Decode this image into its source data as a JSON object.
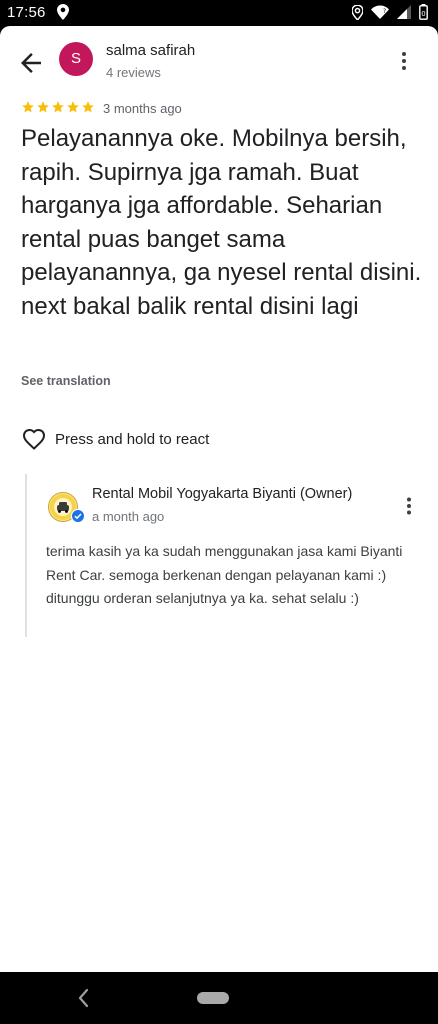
{
  "status_bar": {
    "time": "17:56"
  },
  "review": {
    "avatar_letter": "S",
    "avatar_color": "#c2185b",
    "reviewer_name": "salma safirah",
    "reviewer_reviews": "4 reviews",
    "rating": 5,
    "max_rating": 5,
    "time": "3 months ago",
    "text": "Pelayanannya oke. Mobilnya bersih, rapih. Supirnya jga ramah. Buat harganya jga affordable. Seharian rental puas banget sama pelayanannya, ga nyesel rental disini. next bakal balik rental disini lagi",
    "see_translation": "See translation",
    "react_label": "Press and hold to react"
  },
  "owner_reply": {
    "name": "Rental Mobil Yogyakarta Biyanti (Owner)",
    "time": "a month ago",
    "text": "terima kasih ya ka sudah menggunakan jasa kami Biyanti Rent Car. semoga berkenan dengan pelayanan kami :) ditunggu orderan selanjutnya ya ka. sehat selalu :)"
  },
  "colors": {
    "star": "#fbbc04",
    "verified": "#1a73e8",
    "text_primary": "#202124",
    "text_secondary": "#70757a"
  },
  "icons": [
    "location-icon",
    "wifi-icon",
    "signal-icon",
    "battery-icon",
    "back-arrow-icon",
    "more-vert-icon",
    "star-icon",
    "heart-outline-icon",
    "verified-badge-icon",
    "nav-back-icon",
    "nav-home-pill"
  ]
}
